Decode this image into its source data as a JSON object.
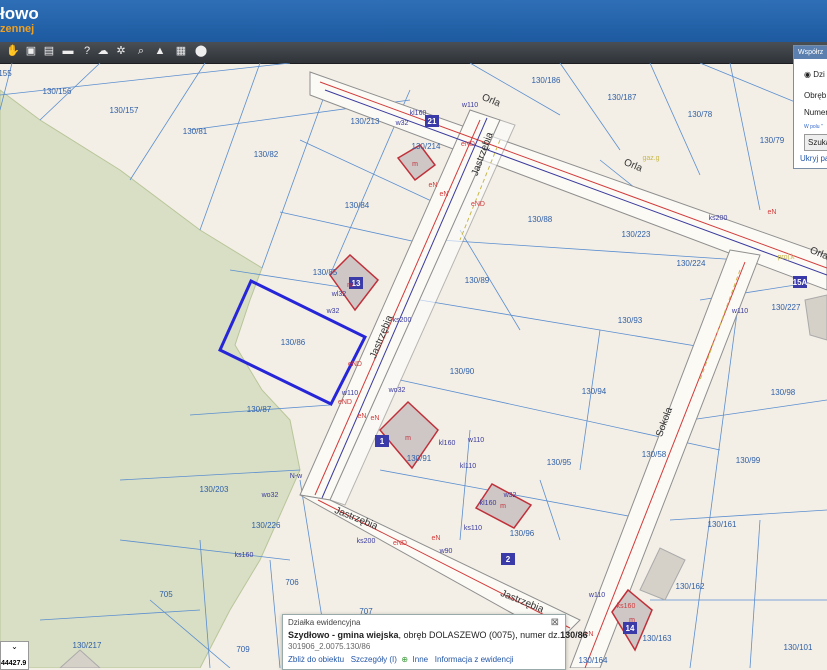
{
  "header": {
    "title": "łowo",
    "subtitle": "zennej"
  },
  "toolbar": {
    "tools": [
      {
        "icon": "pan-icon",
        "glyph": "✋"
      },
      {
        "icon": "layers-icon",
        "glyph": "▣"
      },
      {
        "icon": "table-icon",
        "glyph": "▤"
      },
      {
        "icon": "comment-icon",
        "glyph": "▬"
      },
      {
        "icon": "help-icon",
        "glyph": "?"
      },
      {
        "icon": "cloud-icon",
        "glyph": "☁"
      },
      {
        "icon": "settings-icon",
        "glyph": "✲"
      },
      {
        "icon": "search-icon",
        "glyph": "⌕"
      },
      {
        "icon": "measure-icon",
        "glyph": "▲"
      },
      {
        "icon": "color-grid-icon",
        "glyph": "▦"
      },
      {
        "icon": "share-icon",
        "glyph": "⬤"
      }
    ]
  },
  "search_panel": {
    "title": "Współrz",
    "option_label": "Dzi",
    "obreb_label": "Obręb:",
    "numer_label": "Numer",
    "hint": "W polu \"",
    "search_button": "Szuka",
    "hide_link": "Ukryj pan"
  },
  "parcels": [
    {
      "label": "155"
    },
    {
      "label": "130/156"
    },
    {
      "label": "130/157"
    },
    {
      "label": "130/81"
    },
    {
      "label": "130/82"
    },
    {
      "label": "130/213"
    },
    {
      "label": "130/214"
    },
    {
      "label": "130/84"
    },
    {
      "label": "130/85"
    },
    {
      "label": "130/86"
    },
    {
      "label": "130/87"
    },
    {
      "label": "130/203"
    },
    {
      "label": "130/226"
    },
    {
      "label": "706"
    },
    {
      "label": "705"
    },
    {
      "label": "707"
    },
    {
      "label": "709"
    },
    {
      "label": "130/217"
    },
    {
      "label": "130/186"
    },
    {
      "label": "130/187"
    },
    {
      "label": "130/78"
    },
    {
      "label": "130/79"
    },
    {
      "label": "130/88"
    },
    {
      "label": "130/223"
    },
    {
      "label": "130/224"
    },
    {
      "label": "130/89"
    },
    {
      "label": "130/93"
    },
    {
      "label": "130/90"
    },
    {
      "label": "130/94"
    },
    {
      "label": "130/91"
    },
    {
      "label": "130/95"
    },
    {
      "label": "130/96"
    },
    {
      "label": "130/98"
    },
    {
      "label": "130/99"
    },
    {
      "label": "130/58"
    },
    {
      "label": "130/161"
    },
    {
      "label": "130/162"
    },
    {
      "label": "130/163"
    },
    {
      "label": "130/164"
    },
    {
      "label": "130/101"
    },
    {
      "label": "130/227"
    }
  ],
  "streets": [
    {
      "label": "Orla"
    },
    {
      "label": "Orla"
    },
    {
      "label": "Jastrzębia"
    },
    {
      "label": "Jastrzębia"
    },
    {
      "label": "Jastrzębia"
    },
    {
      "label": "Jastrzębia"
    },
    {
      "label": "Sokola"
    },
    {
      "label": "Orła"
    }
  ],
  "building_numbers": [
    {
      "label": "21"
    },
    {
      "label": "13"
    },
    {
      "label": "1"
    },
    {
      "label": "2"
    },
    {
      "label": "15A"
    },
    {
      "label": "14"
    }
  ],
  "building_marks": [
    "m",
    "m",
    "m",
    "m",
    "m"
  ],
  "utility_labels": [
    "w110",
    "kl160",
    "w32",
    "eN",
    "eN",
    "eND",
    "eND",
    "gaz.g",
    "ks200",
    "eN",
    "w32",
    "wl32",
    "ks200",
    "eND",
    "w110",
    "eN",
    "wo32",
    "kl160",
    "w110",
    "kl110",
    "w32",
    "kl160",
    "ks110",
    "w90",
    "eND",
    "eN",
    "ks200",
    "eND",
    "w110",
    "ks160",
    "eN",
    "wo32",
    "ks160",
    "proj.k",
    "w110",
    "eN",
    "N-w"
  ],
  "selected_parcel": "130/86",
  "info_popup": {
    "heading": "Działka ewidencyjna",
    "name": "Szydłowo - gmina wiejska",
    "details": ", obręb DOLASZEWO (0075), numer dz.",
    "number": "130/86",
    "identifier": "301906_2.0075.130/86",
    "link_zoom": "Zbliż do obiektu",
    "link_details": "Szczegóły (I)",
    "link_more": "Inne",
    "link_info": "Informacja z ewidencji",
    "close_glyph": "⊠"
  },
  "coordinate_readout": "44427.9",
  "colors": {
    "highlight": "#2626d8",
    "forest": "#d8dfc4",
    "road": "#ffffff",
    "parcel_line": "#5b8ed0",
    "building": "#c0303a"
  }
}
